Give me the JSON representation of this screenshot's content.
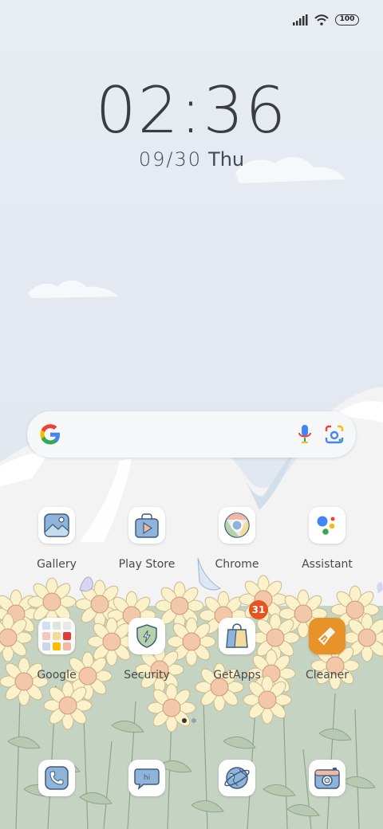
{
  "status_bar": {
    "battery_level": "100",
    "icons": [
      "signal-icon",
      "wifi-icon",
      "battery-icon"
    ]
  },
  "clock": {
    "time": "02:36",
    "date": "09/30",
    "weekday": "Thu"
  },
  "search_bar": {
    "icons": [
      "google-logo-icon",
      "microphone-icon",
      "google-lens-icon"
    ]
  },
  "apps_row1": [
    {
      "label": "Gallery",
      "icon": "gallery-icon"
    },
    {
      "label": "Play Store",
      "icon": "play-store-icon"
    },
    {
      "label": "Chrome",
      "icon": "chrome-icon"
    },
    {
      "label": "Assistant",
      "icon": "assistant-icon"
    }
  ],
  "apps_row2": [
    {
      "label": "Google",
      "icon": "folder-icon"
    },
    {
      "label": "Security",
      "icon": "security-icon"
    },
    {
      "label": "GetApps",
      "icon": "getapps-icon",
      "badge": "31"
    },
    {
      "label": "Cleaner",
      "icon": "cleaner-icon"
    }
  ],
  "dock": [
    {
      "icon": "phone-icon"
    },
    {
      "icon": "messaging-icon",
      "text": "hi"
    },
    {
      "icon": "browser-icon"
    },
    {
      "icon": "camera-icon"
    }
  ],
  "page_indicator": {
    "pages": 2,
    "current": 1
  },
  "colors": {
    "sky": "#e6ebf2",
    "badge": "#e8521f",
    "cleaner": "#e8922a",
    "icon_blue": "#7fa6cf"
  }
}
